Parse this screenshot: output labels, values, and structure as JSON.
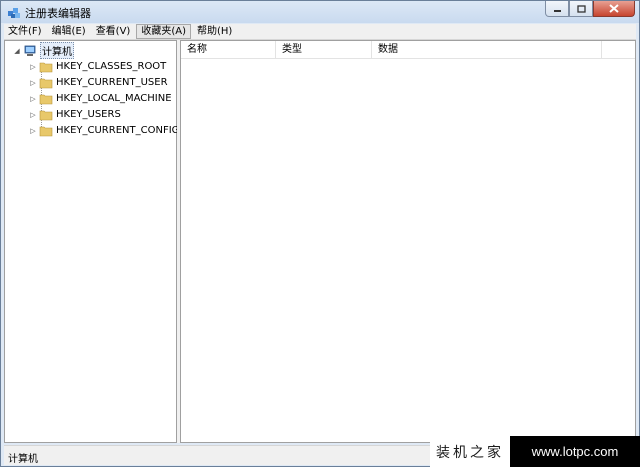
{
  "window": {
    "title": "注册表编辑器",
    "icon": "regedit-icon"
  },
  "menu": [
    {
      "label": "文件(F)"
    },
    {
      "label": "编辑(E)"
    },
    {
      "label": "查看(V)"
    },
    {
      "label": "收藏夹(A)",
      "active": true
    },
    {
      "label": "帮助(H)"
    }
  ],
  "tree": {
    "root": {
      "label": "计算机",
      "icon": "computer-icon",
      "expanded": true
    },
    "children": [
      {
        "label": "HKEY_CLASSES_ROOT",
        "icon": "folder-icon"
      },
      {
        "label": "HKEY_CURRENT_USER",
        "icon": "folder-icon"
      },
      {
        "label": "HKEY_LOCAL_MACHINE",
        "icon": "folder-icon"
      },
      {
        "label": "HKEY_USERS",
        "icon": "folder-icon"
      },
      {
        "label": "HKEY_CURRENT_CONFIG",
        "icon": "folder-icon"
      }
    ]
  },
  "list": {
    "columns": [
      "名称",
      "类型",
      "数据"
    ]
  },
  "status": {
    "text": "计算机"
  },
  "watermark": {
    "left": "装机之家",
    "right": "www.lotpc.com"
  }
}
